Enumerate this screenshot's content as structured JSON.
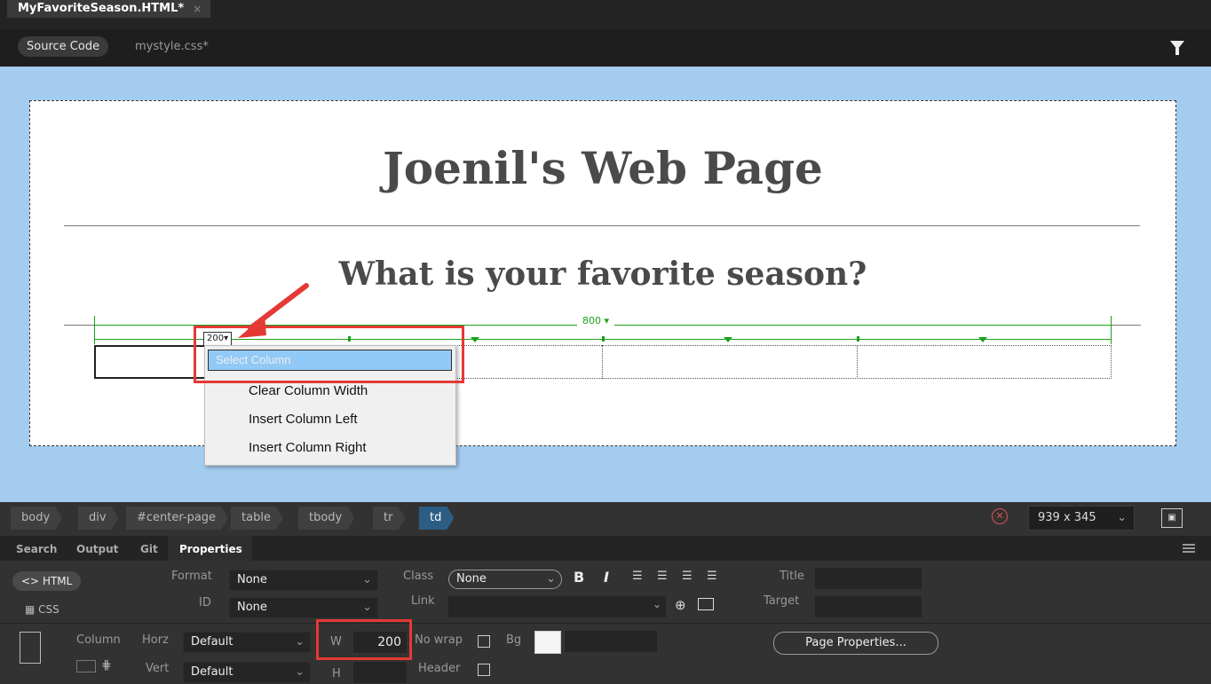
{
  "document_tab": {
    "title": "MyFavoriteSeason.HTML*",
    "close": "×"
  },
  "view_tabs": {
    "source": "Source Code",
    "related_file": "mystyle.css*"
  },
  "page": {
    "heading": "Joenil's Web Page",
    "subheading": "What is your favorite season?",
    "table_width": "800",
    "column_width_badge": "200"
  },
  "context_menu": {
    "items": [
      "Select Column",
      "Clear Column Width",
      "Insert Column Left",
      "Insert Column Right"
    ],
    "selected_index": 0
  },
  "tag_selector": [
    "body",
    "div",
    "#center-page",
    "table",
    "tbody",
    "tr",
    "td"
  ],
  "window_size": {
    "value": "939 x 345"
  },
  "panel_tabs": [
    "Search",
    "Output",
    "Git",
    "Properties"
  ],
  "properties": {
    "html_button": "HTML",
    "css_button": "CSS",
    "format_label": "Format",
    "format_value": "None",
    "id_label": "ID",
    "id_value": "None",
    "class_label": "Class",
    "class_value": "None",
    "link_label": "Link",
    "title_label": "Title",
    "target_label": "Target",
    "bold": "B",
    "italic": "I",
    "column_label": "Column",
    "horz_label": "Horz",
    "horz_value": "Default",
    "vert_label": "Vert",
    "vert_value": "Default",
    "w_label": "W",
    "w_value": "200",
    "h_label": "H",
    "nowrap_label": "No wrap",
    "header_label": "Header",
    "bg_label": "Bg",
    "page_properties_button": "Page Properties..."
  },
  "colors": {
    "accent_red": "#e53935",
    "design_bg": "#a3ccef",
    "menu_highlight": "#91c9f7",
    "ruler_green": "#1aa11a"
  }
}
